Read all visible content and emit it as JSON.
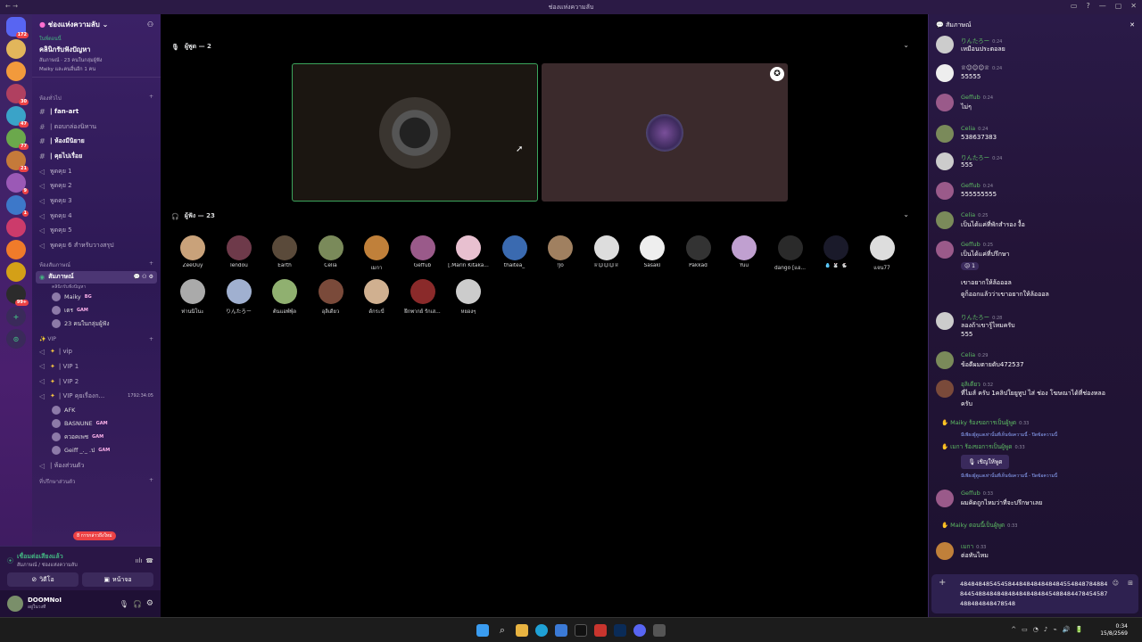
{
  "window": {
    "title": "ช่องแห่งความลับ"
  },
  "servers": [
    {
      "icon": "discord-home-icon",
      "badge": "172",
      "color": "#5865f2"
    },
    {
      "icon": "server-1",
      "badge": "",
      "color": "#e2b65b"
    },
    {
      "icon": "server-2",
      "badge": "",
      "color": "#f29a3c"
    },
    {
      "icon": "server-3",
      "badge": "30",
      "color": "#b04060"
    },
    {
      "icon": "server-4",
      "badge": "47",
      "color": "#3aa3c8"
    },
    {
      "icon": "server-5",
      "badge": "77",
      "color": "#6ba84c"
    },
    {
      "icon": "server-6",
      "badge": "21",
      "color": "#c57a3a"
    },
    {
      "icon": "server-7",
      "badge": "9",
      "color": "#9b59b6"
    },
    {
      "icon": "server-8",
      "badge": "1",
      "color": "#3d78c9"
    },
    {
      "icon": "server-9",
      "badge": "",
      "color": "#cc3b6b"
    },
    {
      "icon": "server-10",
      "badge": "",
      "color": "#f07b2a"
    },
    {
      "icon": "server-11",
      "badge": "",
      "color": "#d4a017"
    },
    {
      "icon": "server-12",
      "badge": "99+",
      "color": "#2b2b2b"
    }
  ],
  "guild": {
    "name": "ช่องแห่งความลับ"
  },
  "event": {
    "tag": "ในพี่ตอนนี้",
    "title": "คลินิกรับฟังปัญหา",
    "sub1": "สัมภาษณ์ · 23 คนในกลุ่มผู้ฟัง",
    "sub2": "Maiky และคนอื่นอีก 1 คน"
  },
  "categories": {
    "general": "ห้องทั่วไป",
    "interview": "ห้องสัมภาษณ์",
    "vip": "VIP",
    "extra": "ที่ปรึกษาส่วนตัว"
  },
  "general_channels": [
    "| fan-art",
    "| ตอบกล่องนิทาน",
    "| ห้องมีนิยาย",
    "| คุยไปเรื่อย",
    "พูดคุย 1",
    "พูดคุย 2",
    "พูดคุย 3",
    "พูดคุย 4",
    "พูดคุย 5",
    "พูดคุย 6 สำหรับวางสรุป"
  ],
  "interview_channel": {
    "name": "สัมภาษณ์",
    "desc": "คลินิกรับฟังปัญหา"
  },
  "interview_users": [
    {
      "name": "Maiky",
      "tag": "BG"
    },
    {
      "name": "เตร",
      "tag": "GAM"
    },
    {
      "name": "23 คนในกลุ่มผู้ฟัง",
      "tag": ""
    }
  ],
  "vip_channels": [
    "| vip",
    "| VIP 1",
    "| VIP 2",
    "| VIP คุยเรื่องก..."
  ],
  "vip_timer": "1792:34:05",
  "vip_users": [
    {
      "name": "AFK",
      "tag": ""
    },
    {
      "name": "BASNUNE",
      "tag": "GAM"
    },
    {
      "name": "ควอคเพช",
      "tag": "GAM"
    },
    {
      "name": "Geiff _._ .ป",
      "tag": "GAM"
    }
  ],
  "extra_channels": [
    "| ห้องส่วนตัว"
  ],
  "new_mentions": "8 การกล่าวถึงใหม่",
  "voice": {
    "status": "เชื่อมต่อเสียงแล้ว",
    "location": "สัมภาษณ์ / ช่องแห่งความลับ",
    "video": "วิดีโอ",
    "screen": "หน้าจอ"
  },
  "user": {
    "name": "DOOMNoI",
    "status": "อยู่ในวงที"
  },
  "stage": {
    "speakers_label": "ผู้พูด — 2",
    "listeners_label": "ผู้ฟัง — 23",
    "listeners": [
      "ZeeOuy",
      "Tendou",
      "Earth",
      "Celia",
      "เมกา",
      "Geffub",
      "[.Marin Kitaka...",
      "thaitea_",
      "!Jo",
      "♕☺︎☺︎☺︎♕",
      "Sasaki",
      "Pakkad",
      "Yuu",
      "dango [แอ...",
      "💧 🐰 🐇",
      "แจน77",
      "ท่านนิโนะ",
      "りんたろー",
      "ต้นแอพ์พ์ุล",
      "อุลิเดียว",
      "ดักระบี่",
      "ฝึกพากย์ รักเส...",
      "หยองๆ"
    ]
  },
  "chat": {
    "title": "สัมภาษณ์",
    "messages": [
      {
        "author": "りんたろー",
        "time": "0:24",
        "text": "เหมือนประตอลย",
        "color": "#5dbb63"
      },
      {
        "author": "♕☺︎☺︎☺︎♕",
        "time": "0:24",
        "text": "55555",
        "color": "#dcddde"
      },
      {
        "author": "Geffub",
        "time": "0:24",
        "text": "ไม่ๆ",
        "color": "#5dbb63"
      },
      {
        "author": "Celia",
        "time": "0:24",
        "text": "538637383",
        "color": "#5dbb63"
      },
      {
        "author": "りんたろー",
        "time": "0:24",
        "text": "555",
        "color": "#5dbb63"
      },
      {
        "author": "Geffub",
        "time": "0:24",
        "text": "555555555",
        "color": "#5dbb63"
      },
      {
        "author": "Celia",
        "time": "0:25",
        "text": "เป็นได้แค่ที่พักสำรอง งื้อ",
        "color": "#5dbb63"
      },
      {
        "author": "Geffub",
        "time": "0:25",
        "text": "เป็นได้แค่ที่ปรึกษา",
        "color": "#5dbb63"
      },
      {
        "author": "",
        "time": "",
        "text": "เขาอยากให้ล้อออล",
        "color": ""
      },
      {
        "author": "",
        "time": "",
        "text": "ดูก็ออกแล้วว่าเขาอยากให้ล้อออล",
        "color": ""
      },
      {
        "author": "りんたろー",
        "time": "0:28",
        "text": "ลองถ้าเขารู้ไหมครับ",
        "color": "#5dbb63"
      },
      {
        "author": "",
        "time": "",
        "text": "555",
        "color": ""
      },
      {
        "author": "Celia",
        "time": "0:29",
        "text": "ข้อดีผมตายดับ472537",
        "color": "#5dbb63"
      },
      {
        "author": "อุลิเดียว",
        "time": "0:32",
        "text": "ที่ไมส์ ครับ 1คลิปใยยูทูป ไส่ ช่อง โฆษณาได้ที่ช่องหลอ",
        "color": "#5dbb63"
      },
      {
        "author": "",
        "time": "",
        "text": "ครับ",
        "color": ""
      },
      {
        "author": "Geffub",
        "time": "0:33",
        "text": "ผมคิดถูกไหมว่าที่จะปรึกษาเลย",
        "color": "#5dbb63"
      },
      {
        "author": "เมกา",
        "time": "0:33",
        "text": "ต่อทันไหม",
        "color": "#5dbb63"
      }
    ],
    "sys1": "Maiky ร้องขอการเป็นผู้พูด",
    "sys1_time": "0:33",
    "sys1_note": "มีเพียงผู้ดูแลเท่านั้นที่เห็นข้อความนี้ - ปิดข้อความนี้",
    "sys2": "เมกา ร้องขอการเป็นผู้พูด",
    "sys2_time": "0:33",
    "invite": "เชิญให้พูด",
    "sys2_note": "มีเพียงผู้ดูแลเท่านั้นที่เห็นข้อความนี้ - ปิดข้อความนี้",
    "sys3": "Maiky ตอนนี้เป็นผู้พูด",
    "sys3_time": "0:33",
    "react_count": "1",
    "input_text": "48484848545458448484848484845548487848848445488484848484848484845488484478454587488484848478548"
  },
  "taskbar": {
    "time": "0:34",
    "date": "15/8/2569"
  }
}
